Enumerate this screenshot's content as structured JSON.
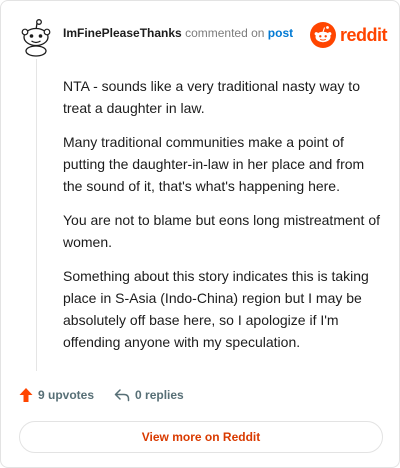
{
  "comment": {
    "username": "ImFinePleaseThanks",
    "action_text": "commented on",
    "post_link": "post",
    "paragraphs": [
      "NTA - sounds like a very traditional nasty way to treat a daughter in law.",
      "Many traditional communities make a point of putting the daughter-in-law in her place and from the sound of it, that's what's happening here.",
      "You are not to blame but eons long mistreatment of women.",
      "Something about this story indicates this is taking place in S-Asia (Indo-China) region but I may be absolutely off base here, so I apologize if I'm offending anyone with my speculation."
    ]
  },
  "brand": {
    "name": "reddit",
    "icon": "reddit-snoo-icon",
    "color": "#ff4500"
  },
  "actions": {
    "upvotes_label": "9 upvotes",
    "upvote_icon": "upvote-arrow-icon",
    "upvote_color": "#ff4500",
    "replies_label": "0 replies",
    "reply_icon": "reply-arrow-icon"
  },
  "footer": {
    "view_more_label": "View more on Reddit"
  }
}
